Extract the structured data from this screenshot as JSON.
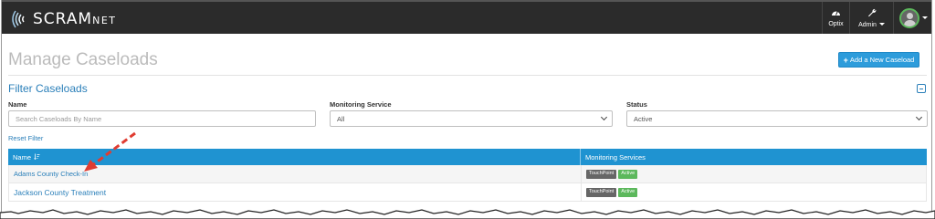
{
  "app": {
    "brand_main": "SCRAM",
    "brand_sub": "NET"
  },
  "nav": {
    "optix_label": "Optix",
    "admin_label": "Admin",
    "icons": {
      "optix": "dashboard-icon",
      "admin": "wrench-icon",
      "user": "user-avatar-icon"
    }
  },
  "page": {
    "title": "Manage Caseloads",
    "add_button_label": "Add a New Caseload"
  },
  "filter": {
    "title": "Filter Caseloads",
    "name_label": "Name",
    "name_placeholder": "Search Caseloads By Name",
    "service_label": "Monitoring Service",
    "service_value": "All",
    "status_label": "Status",
    "status_value": "Active",
    "reset_label": "Reset Filter"
  },
  "table": {
    "headers": {
      "name": "Name",
      "services": "Monitoring Services"
    },
    "rows": [
      {
        "name": "Adams County Check-In",
        "service": "TouchPoint",
        "status": "Active"
      },
      {
        "name": "Jackson County Treatment",
        "service": "TouchPoint",
        "status": "Active"
      }
    ]
  },
  "colors": {
    "navbar": "#2b2b2b",
    "accent": "#2d9cdb",
    "table_header": "#1f93d1",
    "active_badge": "#5cb85c",
    "annotation_arrow": "#e03c31"
  }
}
